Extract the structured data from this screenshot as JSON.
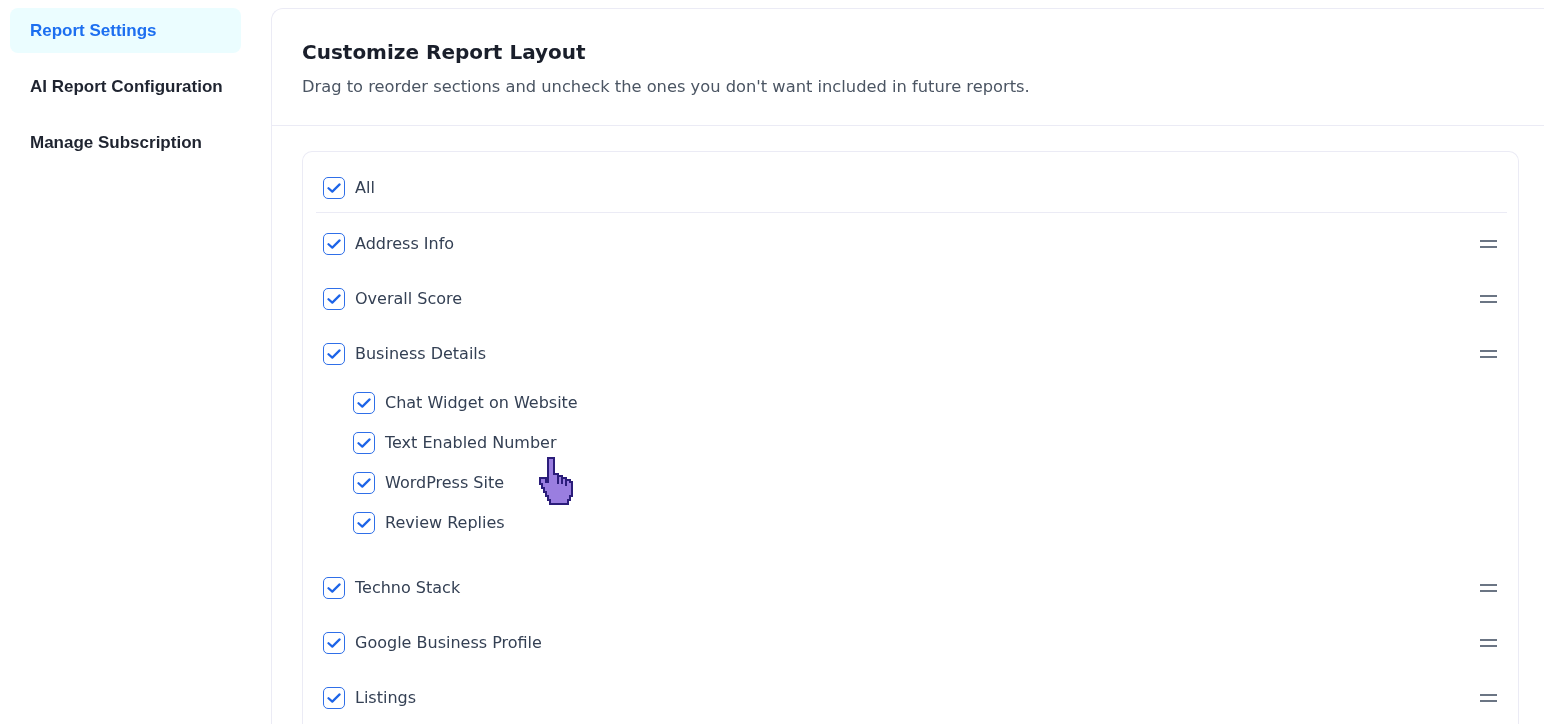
{
  "sidebar": {
    "items": [
      {
        "label": "Report Settings",
        "selected": true
      },
      {
        "label": "AI Report Configuration",
        "selected": false
      },
      {
        "label": "Manage Subscription",
        "selected": false
      }
    ]
  },
  "panel": {
    "title": "Customize Report Layout",
    "description": "Drag to reorder sections and uncheck the ones you don't want included in future reports.",
    "select_all": {
      "label": "All",
      "checked": true
    },
    "sections": [
      {
        "label": "Address Info",
        "checked": true
      },
      {
        "label": "Overall Score",
        "checked": true
      },
      {
        "label": "Business Details",
        "checked": true,
        "children": [
          {
            "label": "Chat Widget on Website",
            "checked": true
          },
          {
            "label": "Text Enabled Number",
            "checked": true
          },
          {
            "label": "WordPress Site",
            "checked": true
          },
          {
            "label": "Review Replies",
            "checked": true
          }
        ]
      },
      {
        "label": "Techno Stack",
        "checked": true
      },
      {
        "label": "Google Business Profile",
        "checked": true
      },
      {
        "label": "Listings",
        "checked": true
      }
    ]
  }
}
